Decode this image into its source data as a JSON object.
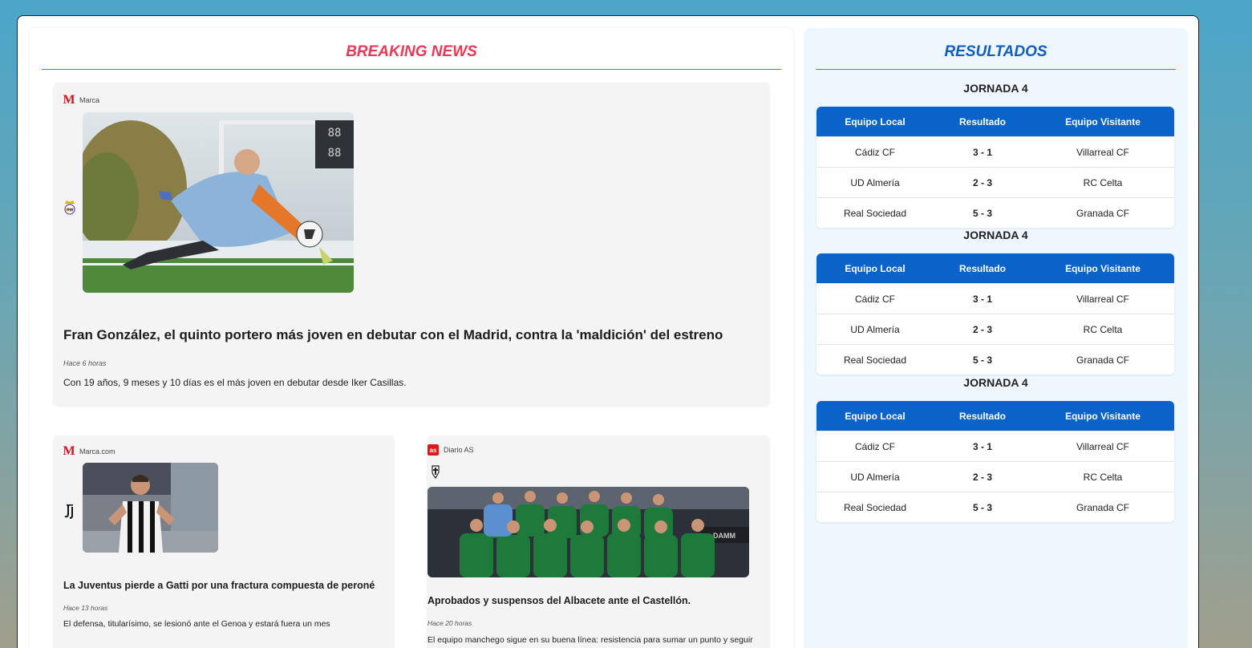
{
  "news": {
    "title": "BREAKING NEWS",
    "main": {
      "source": "Marca",
      "headline": "Fran González, el quinto portero más joven en debutar con el Madrid, contra la 'maldición' del estreno",
      "time": "Hace 6 horas",
      "summary": "Con 19 años, 9 meses y 10 días es el más joven en debutar desde Iker Casillas.",
      "team_icon": "real-madrid-crest-icon"
    },
    "cards": [
      {
        "source": "Marca.com",
        "headline": "La Juventus pierde a Gatti por una fractura compuesta de peroné",
        "time": "Hace 13 horas",
        "summary": "El defensa, titularísimo, se lesionó ante el Genoa y estará fuera un mes",
        "team_icon": "juventus-crest-icon"
      },
      {
        "source": "Diario AS",
        "headline": "Aprobados y suspensos del Albacete ante el Castellón.",
        "time": "Hace 20 horas",
        "summary": "El equipo manchego sigue en su buena línea: resistencia para sumar un punto y seguir",
        "team_icon": "albacete-crest-icon"
      }
    ]
  },
  "results": {
    "title": "RESULTADOS",
    "headers": [
      "Equipo Local",
      "Resultado",
      "Equipo Visitante"
    ],
    "rounds": [
      {
        "label": "JORNADA 4",
        "matches": [
          {
            "home": "Cádiz CF",
            "score": "3 - 1",
            "away": "Villarreal CF"
          },
          {
            "home": "UD Almería",
            "score": "2 - 3",
            "away": "RC Celta"
          },
          {
            "home": "Real Sociedad",
            "score": "5 - 3",
            "away": "Granada CF"
          }
        ]
      },
      {
        "label": "JORNADA 4",
        "matches": [
          {
            "home": "Cádiz CF",
            "score": "3 - 1",
            "away": "Villarreal CF"
          },
          {
            "home": "UD Almería",
            "score": "2 - 3",
            "away": "RC Celta"
          },
          {
            "home": "Real Sociedad",
            "score": "5 - 3",
            "away": "Granada CF"
          }
        ]
      },
      {
        "label": "JORNADA 4",
        "matches": [
          {
            "home": "Cádiz CF",
            "score": "3 - 1",
            "away": "Villarreal CF"
          },
          {
            "home": "UD Almería",
            "score": "2 - 3",
            "away": "RC Celta"
          },
          {
            "home": "Real Sociedad",
            "score": "5 - 3",
            "away": "Granada CF"
          }
        ]
      }
    ]
  },
  "colors": {
    "news_title": "#ef3755",
    "results_title": "#0e5fc4",
    "table_header": "#0a63c9"
  }
}
